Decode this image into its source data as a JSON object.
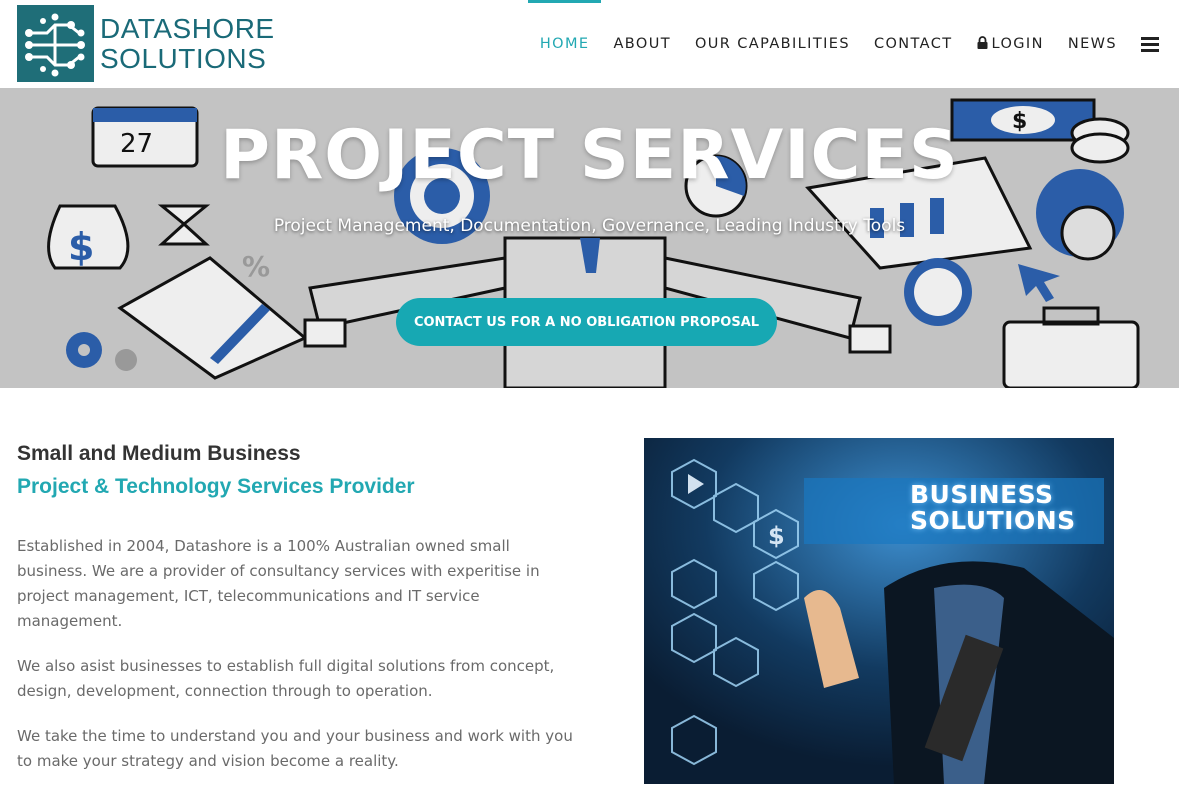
{
  "brand": {
    "line1": "DATASHORE",
    "line2": "SOLUTIONS",
    "color": "#1a6a78"
  },
  "nav": {
    "items": [
      {
        "label": "HOME",
        "active": true
      },
      {
        "label": "ABOUT"
      },
      {
        "label": "OUR CAPABILITIES"
      },
      {
        "label": "CONTACT"
      },
      {
        "label": "LOGIN",
        "icon": "lock-icon"
      },
      {
        "label": "NEWS"
      }
    ],
    "menu_icon": "hamburger-icon",
    "accent": "#22a8b2"
  },
  "hero": {
    "title": "PROJECT SERVICES",
    "subtitle": "Project Management, Documentation, Governance, Leading Industry Tools",
    "cta": "CONTACT US FOR A NO OBLIGATION PROPOSAL",
    "calendar_day": "27",
    "cta_color": "#17a8b3"
  },
  "intro": {
    "heading": "Small and Medium Business",
    "subheading": "Project & Technology Services Provider",
    "paragraphs": [
      "Established in 2004, Datashore is a 100% Australian owned small business. We are a provider of consultancy services with experitise in project management, ICT, telecommunications and IT service management.",
      "We also asist businesses to establish full digital solutions from concept, design, development, connection through to operation.",
      "We take the time to understand you and your business and work with you to make your strategy and vision become a reality."
    ]
  },
  "photo": {
    "label_line1": "BUSINESS",
    "label_line2": "SOLUTIONS"
  }
}
